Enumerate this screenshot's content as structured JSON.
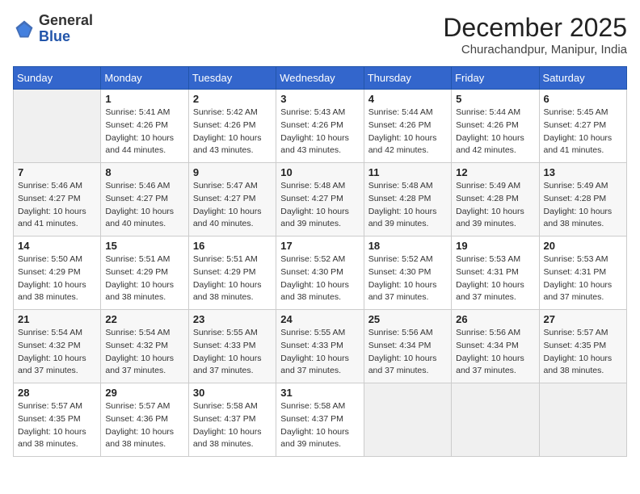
{
  "logo": {
    "general": "General",
    "blue": "Blue"
  },
  "title": "December 2025",
  "location": "Churachandpur, Manipur, India",
  "weekdays": [
    "Sunday",
    "Monday",
    "Tuesday",
    "Wednesday",
    "Thursday",
    "Friday",
    "Saturday"
  ],
  "weeks": [
    [
      {
        "day": "",
        "sunrise": "",
        "sunset": "",
        "daylight": ""
      },
      {
        "day": "1",
        "sunrise": "Sunrise: 5:41 AM",
        "sunset": "Sunset: 4:26 PM",
        "daylight": "Daylight: 10 hours and 44 minutes."
      },
      {
        "day": "2",
        "sunrise": "Sunrise: 5:42 AM",
        "sunset": "Sunset: 4:26 PM",
        "daylight": "Daylight: 10 hours and 43 minutes."
      },
      {
        "day": "3",
        "sunrise": "Sunrise: 5:43 AM",
        "sunset": "Sunset: 4:26 PM",
        "daylight": "Daylight: 10 hours and 43 minutes."
      },
      {
        "day": "4",
        "sunrise": "Sunrise: 5:44 AM",
        "sunset": "Sunset: 4:26 PM",
        "daylight": "Daylight: 10 hours and 42 minutes."
      },
      {
        "day": "5",
        "sunrise": "Sunrise: 5:44 AM",
        "sunset": "Sunset: 4:26 PM",
        "daylight": "Daylight: 10 hours and 42 minutes."
      },
      {
        "day": "6",
        "sunrise": "Sunrise: 5:45 AM",
        "sunset": "Sunset: 4:27 PM",
        "daylight": "Daylight: 10 hours and 41 minutes."
      }
    ],
    [
      {
        "day": "7",
        "sunrise": "Sunrise: 5:46 AM",
        "sunset": "Sunset: 4:27 PM",
        "daylight": "Daylight: 10 hours and 41 minutes."
      },
      {
        "day": "8",
        "sunrise": "Sunrise: 5:46 AM",
        "sunset": "Sunset: 4:27 PM",
        "daylight": "Daylight: 10 hours and 40 minutes."
      },
      {
        "day": "9",
        "sunrise": "Sunrise: 5:47 AM",
        "sunset": "Sunset: 4:27 PM",
        "daylight": "Daylight: 10 hours and 40 minutes."
      },
      {
        "day": "10",
        "sunrise": "Sunrise: 5:48 AM",
        "sunset": "Sunset: 4:27 PM",
        "daylight": "Daylight: 10 hours and 39 minutes."
      },
      {
        "day": "11",
        "sunrise": "Sunrise: 5:48 AM",
        "sunset": "Sunset: 4:28 PM",
        "daylight": "Daylight: 10 hours and 39 minutes."
      },
      {
        "day": "12",
        "sunrise": "Sunrise: 5:49 AM",
        "sunset": "Sunset: 4:28 PM",
        "daylight": "Daylight: 10 hours and 39 minutes."
      },
      {
        "day": "13",
        "sunrise": "Sunrise: 5:49 AM",
        "sunset": "Sunset: 4:28 PM",
        "daylight": "Daylight: 10 hours and 38 minutes."
      }
    ],
    [
      {
        "day": "14",
        "sunrise": "Sunrise: 5:50 AM",
        "sunset": "Sunset: 4:29 PM",
        "daylight": "Daylight: 10 hours and 38 minutes."
      },
      {
        "day": "15",
        "sunrise": "Sunrise: 5:51 AM",
        "sunset": "Sunset: 4:29 PM",
        "daylight": "Daylight: 10 hours and 38 minutes."
      },
      {
        "day": "16",
        "sunrise": "Sunrise: 5:51 AM",
        "sunset": "Sunset: 4:29 PM",
        "daylight": "Daylight: 10 hours and 38 minutes."
      },
      {
        "day": "17",
        "sunrise": "Sunrise: 5:52 AM",
        "sunset": "Sunset: 4:30 PM",
        "daylight": "Daylight: 10 hours and 38 minutes."
      },
      {
        "day": "18",
        "sunrise": "Sunrise: 5:52 AM",
        "sunset": "Sunset: 4:30 PM",
        "daylight": "Daylight: 10 hours and 37 minutes."
      },
      {
        "day": "19",
        "sunrise": "Sunrise: 5:53 AM",
        "sunset": "Sunset: 4:31 PM",
        "daylight": "Daylight: 10 hours and 37 minutes."
      },
      {
        "day": "20",
        "sunrise": "Sunrise: 5:53 AM",
        "sunset": "Sunset: 4:31 PM",
        "daylight": "Daylight: 10 hours and 37 minutes."
      }
    ],
    [
      {
        "day": "21",
        "sunrise": "Sunrise: 5:54 AM",
        "sunset": "Sunset: 4:32 PM",
        "daylight": "Daylight: 10 hours and 37 minutes."
      },
      {
        "day": "22",
        "sunrise": "Sunrise: 5:54 AM",
        "sunset": "Sunset: 4:32 PM",
        "daylight": "Daylight: 10 hours and 37 minutes."
      },
      {
        "day": "23",
        "sunrise": "Sunrise: 5:55 AM",
        "sunset": "Sunset: 4:33 PM",
        "daylight": "Daylight: 10 hours and 37 minutes."
      },
      {
        "day": "24",
        "sunrise": "Sunrise: 5:55 AM",
        "sunset": "Sunset: 4:33 PM",
        "daylight": "Daylight: 10 hours and 37 minutes."
      },
      {
        "day": "25",
        "sunrise": "Sunrise: 5:56 AM",
        "sunset": "Sunset: 4:34 PM",
        "daylight": "Daylight: 10 hours and 37 minutes."
      },
      {
        "day": "26",
        "sunrise": "Sunrise: 5:56 AM",
        "sunset": "Sunset: 4:34 PM",
        "daylight": "Daylight: 10 hours and 37 minutes."
      },
      {
        "day": "27",
        "sunrise": "Sunrise: 5:57 AM",
        "sunset": "Sunset: 4:35 PM",
        "daylight": "Daylight: 10 hours and 38 minutes."
      }
    ],
    [
      {
        "day": "28",
        "sunrise": "Sunrise: 5:57 AM",
        "sunset": "Sunset: 4:35 PM",
        "daylight": "Daylight: 10 hours and 38 minutes."
      },
      {
        "day": "29",
        "sunrise": "Sunrise: 5:57 AM",
        "sunset": "Sunset: 4:36 PM",
        "daylight": "Daylight: 10 hours and 38 minutes."
      },
      {
        "day": "30",
        "sunrise": "Sunrise: 5:58 AM",
        "sunset": "Sunset: 4:37 PM",
        "daylight": "Daylight: 10 hours and 38 minutes."
      },
      {
        "day": "31",
        "sunrise": "Sunrise: 5:58 AM",
        "sunset": "Sunset: 4:37 PM",
        "daylight": "Daylight: 10 hours and 39 minutes."
      },
      {
        "day": "",
        "sunrise": "",
        "sunset": "",
        "daylight": ""
      },
      {
        "day": "",
        "sunrise": "",
        "sunset": "",
        "daylight": ""
      },
      {
        "day": "",
        "sunrise": "",
        "sunset": "",
        "daylight": ""
      }
    ]
  ]
}
